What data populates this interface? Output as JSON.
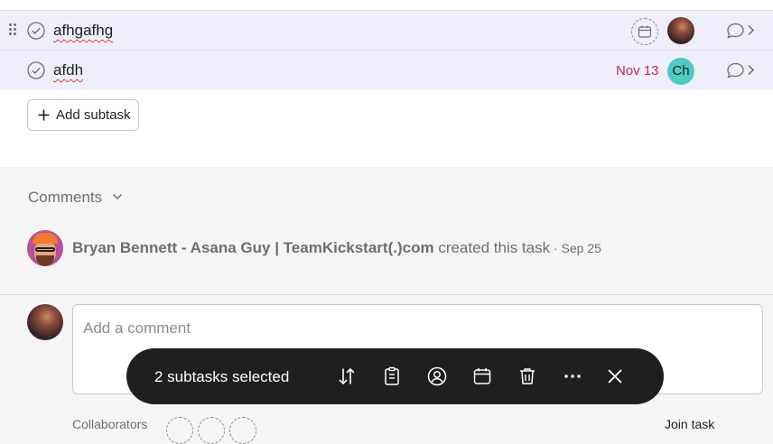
{
  "subtasks": [
    {
      "name": "afhgafhg",
      "due": "",
      "assignee": "photo"
    },
    {
      "name": "afdh",
      "due": "Nov 13",
      "assignee": "Ch"
    }
  ],
  "add_subtask": {
    "label": "Add subtask"
  },
  "comments": {
    "heading": "Comments",
    "activity": {
      "author": "Bryan Bennett - Asana Guy | TeamKickstart(.)com",
      "action": " created this task",
      "date": " · Sep 25"
    },
    "placeholder": "Add a comment"
  },
  "collaborators": {
    "label": "Collaborators",
    "join_label": "Join task"
  },
  "selection_toolbar": {
    "label": "2 subtasks selected",
    "actions": [
      "sort-icon",
      "convert-task-icon",
      "assignee-icon",
      "calendar-icon",
      "trash-icon",
      "more-icon",
      "close-icon"
    ]
  },
  "colors": {
    "due_red": "#c3265d",
    "toolbar_bg": "#1e1f21",
    "row_selected": "#eeeffb",
    "ch_avatar": "#4ecbc4"
  }
}
